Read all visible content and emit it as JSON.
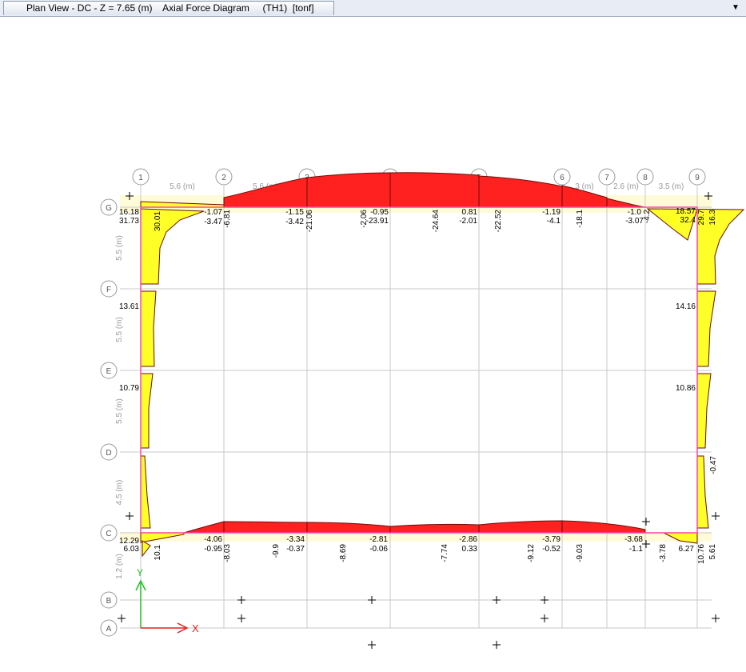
{
  "window": {
    "tab_title": "Plan View - DC - Z = 7.65 (m)    Axial Force Diagram     (TH1)  [tonf]",
    "dropdown_icon": "chevron-down-icon"
  },
  "grid": {
    "columns": [
      "1",
      "2",
      "3",
      "4",
      "5",
      "6",
      "7",
      "8",
      "9"
    ],
    "rows": [
      "G",
      "F",
      "E",
      "D",
      "C",
      "B",
      "A"
    ],
    "col_spacings": [
      "5.6 (m)",
      "5.6 (m)",
      "5.6 (m)",
      "6 (m)",
      "5.6 (m)",
      "3 (m)",
      "2.6 (m)",
      "3.5 (m)"
    ],
    "row_spacings": [
      "5.5 (m)",
      "5.5 (m)",
      "5.5 (m)",
      "4.5 (m)",
      "1.2 (m)"
    ]
  },
  "axes": {
    "x_label": "X",
    "y_label": "Y"
  },
  "labels": {
    "top_beam": [
      "-1.07",
      "-3.47",
      "-6.81",
      "-1.15",
      "-3.42",
      "-21.06",
      "-0.95",
      "-23.91",
      "-2.06",
      "-24.64",
      "0.81",
      "-2.01",
      "-22.52",
      "-1.19",
      "-4.1",
      "-18.1",
      "-1.0",
      "-3.07",
      "-4.2"
    ],
    "bottom_beam": [
      "-4.06",
      "-0.95",
      "-8.03",
      "-9.9",
      "-3.34",
      "-0.37",
      "-8.69",
      "-2.81",
      "-0.06",
      "-7.74",
      "-2.86",
      "0.33",
      "-9.12",
      "-3.79",
      "-0.52",
      "-9.03",
      "-3.68",
      "-1.1",
      "-3.78",
      "6.27"
    ],
    "left_column": [
      "16.18",
      "31.73",
      "30.01",
      "13.61",
      "10.79",
      "12.29",
      "6.03",
      "10.1"
    ],
    "right_column": [
      "18.57",
      "32.4",
      "29.7",
      "16.3",
      "14.16",
      "10.86",
      "-0.47",
      "10.76",
      "5.61"
    ]
  },
  "colors": {
    "compression": "#ff2020",
    "tension": "#ffff28",
    "outline": "#6b0d0d",
    "grid": "#c8c8c8",
    "frame": "#ff44aa"
  }
}
